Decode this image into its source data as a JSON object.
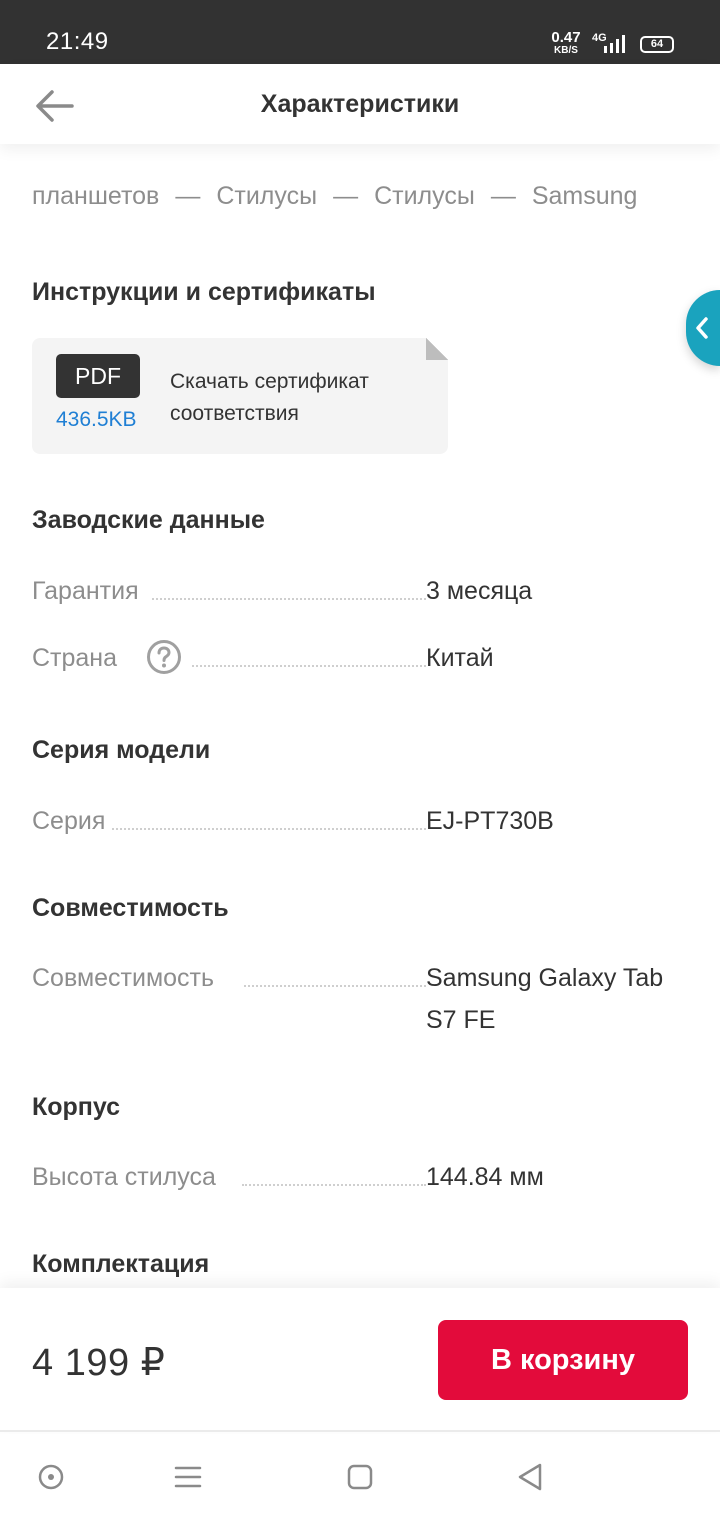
{
  "status_bar": {
    "time": "21:49",
    "net_speed_value": "0.47",
    "net_speed_unit": "KB/S",
    "network": "4G",
    "battery": "64"
  },
  "header": {
    "title": "Характеристики",
    "back_icon": "arrow-left-icon"
  },
  "breadcrumb": [
    "планшетов",
    "Стилусы",
    "Стилусы",
    "Samsung"
  ],
  "breadcrumb_separator": "—",
  "documents": {
    "title": "Инструкции и сертификаты",
    "items": [
      {
        "badge": "PDF",
        "size": "436.5KB",
        "label": "Скачать сертификат соответствия"
      }
    ]
  },
  "sections": [
    {
      "title": "Заводские данные",
      "rows": [
        {
          "label": "Гарантия",
          "value": "3 месяца"
        },
        {
          "label": "Страна",
          "value": "Китай",
          "has_help": true
        }
      ]
    },
    {
      "title": "Серия модели",
      "rows": [
        {
          "label": "Серия",
          "value": "EJ-PT730B"
        }
      ]
    },
    {
      "title": "Совместимость",
      "rows": [
        {
          "label": "Совместимость",
          "value": "Samsung Galaxy Tab S7 FE"
        }
      ]
    },
    {
      "title": "Корпус",
      "rows": [
        {
          "label": "Высота стилуса",
          "value": "144.84 мм"
        }
      ]
    },
    {
      "title": "Комплектация",
      "rows": []
    }
  ],
  "bottom_bar": {
    "price": "4 199 ₽",
    "cart_button": "В корзину"
  },
  "colors": {
    "accent_red": "#e30b3b",
    "side_tab": "#1aa3be",
    "link_blue": "#1f7fd4",
    "status_bar": "#323232"
  }
}
